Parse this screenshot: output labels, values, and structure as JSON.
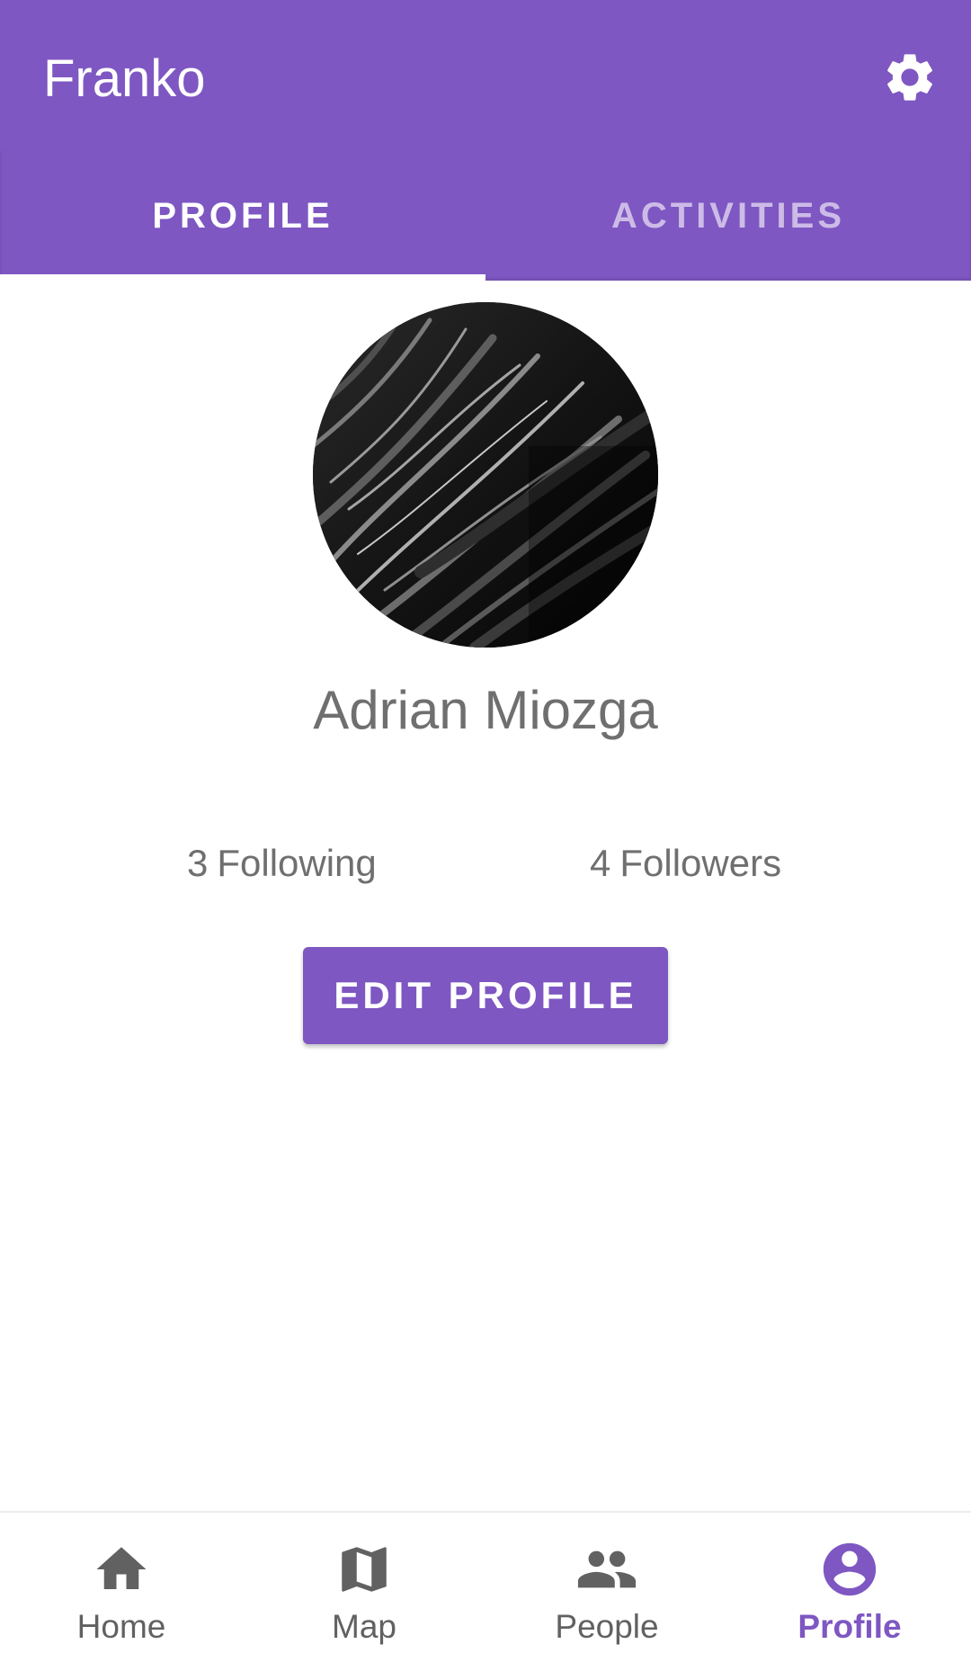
{
  "app": {
    "title": "Franko",
    "accent_color": "#7e57c2"
  },
  "toolbar": {
    "settings_icon": "gear-icon"
  },
  "tabs": [
    {
      "label": "PROFILE",
      "active": true
    },
    {
      "label": "ACTIVITIES",
      "active": false
    }
  ],
  "profile": {
    "avatar_description": "dark rock texture",
    "name": "Adrian Miozga",
    "following_count": "3",
    "following_label": "Following",
    "followers_count": "4",
    "followers_label": "Followers",
    "edit_button_label": "EDIT PROFILE"
  },
  "bottom_nav": {
    "items": [
      {
        "label": "Home",
        "icon": "home-icon",
        "active": false
      },
      {
        "label": "Map",
        "icon": "map-icon",
        "active": false
      },
      {
        "label": "People",
        "icon": "people-icon",
        "active": false
      },
      {
        "label": "Profile",
        "icon": "account-circle-icon",
        "active": true
      }
    ]
  }
}
